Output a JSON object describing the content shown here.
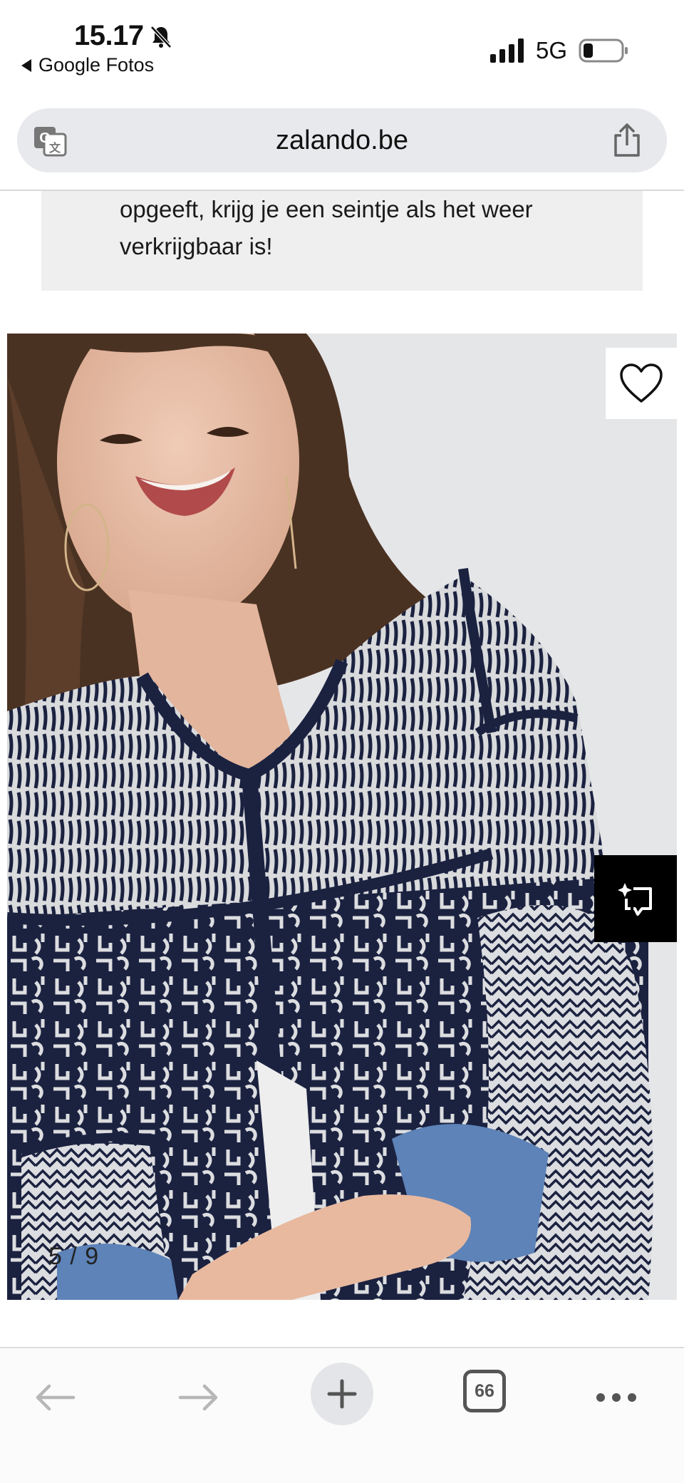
{
  "status_bar": {
    "time": "15.17",
    "back_app": "Google Fotos",
    "network": "5G"
  },
  "address_bar": {
    "url": "zalando.be"
  },
  "notice": {
    "text_line1": "opgeeft, krijg je een seintje als het weer",
    "text_line2": "verkrijgbaar is!"
  },
  "product": {
    "image_description": "Woman wearing navy and white patterned knit cardigan",
    "counter": "5 / 9"
  },
  "toolbar": {
    "tab_count": "66"
  },
  "colors": {
    "address_bg": "#e8e9ec",
    "notice_bg": "#efefef",
    "navy": "#1b2240",
    "cuff_blue": "#5d83b8"
  }
}
